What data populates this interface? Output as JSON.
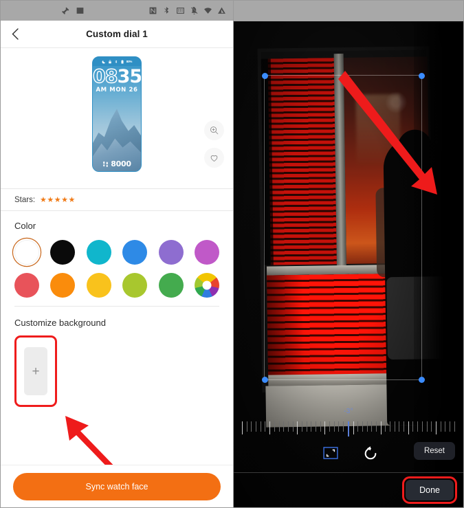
{
  "left": {
    "statusbar": {
      "left_icons": [
        "rocket-icon",
        "image-icon"
      ],
      "right_icons": [
        "nfc-icon",
        "bluetooth-icon",
        "screen-record-icon",
        "notifications-off-icon",
        "wifi-icon",
        "signal-icon"
      ]
    },
    "appbar": {
      "back_icon": "chevron-left-icon",
      "title": "Custom dial 1"
    },
    "watch_preview": {
      "hours": "08",
      "minutes": "35",
      "date": "AM MON 26",
      "battery": "80%",
      "steps": "8000",
      "top_icons": [
        "moon-icon",
        "lock-icon",
        "bluetooth-icon",
        "battery-icon"
      ],
      "zoom_icon": "zoom-in-icon",
      "favorite_icon": "heart-icon"
    },
    "stars": {
      "label": "Stars:",
      "count": 5,
      "glyphs": "★★★★★",
      "color": "#f07b18"
    },
    "color_section": {
      "title": "Color",
      "row1": [
        {
          "name": "white",
          "hex": "#ffffff",
          "selected": true
        },
        {
          "name": "black",
          "hex": "#0a0a0a",
          "selected": false
        },
        {
          "name": "cyan",
          "hex": "#10b6cc",
          "selected": false
        },
        {
          "name": "blue",
          "hex": "#2e8ae6",
          "selected": false
        },
        {
          "name": "purple",
          "hex": "#8e6dd0",
          "selected": false
        },
        {
          "name": "magenta",
          "hex": "#c059c8",
          "selected": false
        }
      ],
      "row2": [
        {
          "name": "red",
          "hex": "#e8535a",
          "selected": false
        },
        {
          "name": "orange",
          "hex": "#fa8c0c",
          "selected": false
        },
        {
          "name": "yellow",
          "hex": "#f9c21c",
          "selected": false
        },
        {
          "name": "lime",
          "hex": "#a8c72e",
          "selected": false
        },
        {
          "name": "green",
          "hex": "#44ab4e",
          "selected": false
        },
        {
          "name": "rainbow",
          "hex": "multi",
          "selected": false
        }
      ]
    },
    "background_section": {
      "title": "Customize background",
      "add_label": "+",
      "highlight_color": "#ef1c1c"
    },
    "sync_button": {
      "label": "Sync watch face",
      "color": "#f36f13"
    }
  },
  "right": {
    "editor": {
      "rotation_value": "-3°",
      "rotation_color": "#6e8ad6",
      "crop_icon": "crop-aspect-icon",
      "rotate_icon": "rotate-left-icon",
      "reset_label": "Reset",
      "done_label": "Done",
      "handle_color": "#3b8cff",
      "highlight_color": "#ef1c1c"
    }
  }
}
